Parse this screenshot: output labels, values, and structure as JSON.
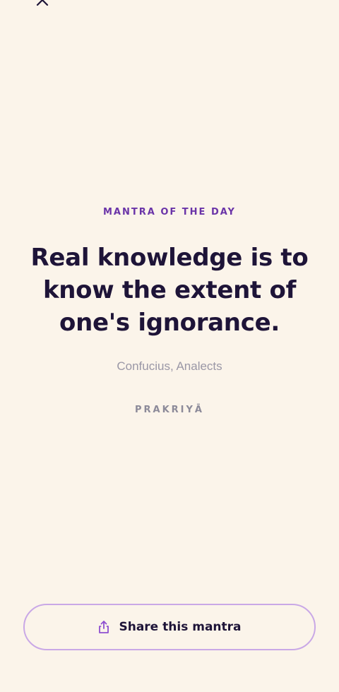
{
  "header": {
    "close_icon": "close-icon"
  },
  "mantra": {
    "eyebrow": "MANTRA OF THE DAY",
    "quote": "Real knowledge is to know the extent of one's ignorance.",
    "attribution": "Confucius, Analects",
    "brand": "PRAKRIYĀ"
  },
  "share": {
    "label": "Share this mantra",
    "icon": "share-icon"
  },
  "colors": {
    "background": "#FBF4EA",
    "accent": "#6A34A8",
    "text": "#1E1438",
    "muted": "#9A97A6",
    "button_border": "#C9A8E6"
  }
}
